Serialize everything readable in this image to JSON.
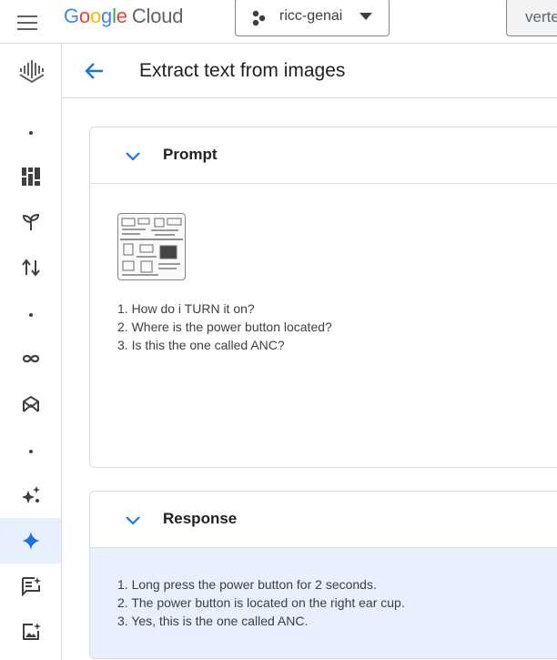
{
  "topbar": {
    "logo_word": [
      "G",
      "o",
      "o",
      "g",
      "l",
      "e"
    ],
    "logo_suffix": "Cloud",
    "project_name": "ricc-genai",
    "search_text": "verte"
  },
  "page": {
    "title": "Extract text from images"
  },
  "prompt": {
    "title": "Prompt",
    "lines": [
      "1. How do i TURN it on?",
      "2. Where is the power button located?",
      "3. Is this the one called ANC?"
    ]
  },
  "response": {
    "title": "Response",
    "lines": [
      "1. Long press the power button for 2 seconds.",
      "2. The power button is located on the right ear cup.",
      "3. Yes, this is the one called ANC."
    ]
  },
  "rail": {
    "items": [
      {
        "icon": "vertex-ai-logo-icon"
      },
      {
        "icon": "dot-icon"
      },
      {
        "icon": "dashboard-icon"
      },
      {
        "icon": "sprout-icon"
      },
      {
        "icon": "swap-vertical-icon"
      },
      {
        "icon": "dot-icon"
      },
      {
        "icon": "infinity-icon"
      },
      {
        "icon": "model-garden-icon"
      },
      {
        "icon": "dot-icon"
      },
      {
        "icon": "sparkle-cluster-icon"
      },
      {
        "icon": "sparkle-icon",
        "active": true
      },
      {
        "icon": "chat-prompt-icon"
      },
      {
        "icon": "image-generation-icon"
      }
    ]
  },
  "colors": {
    "accent_blue": "#1a73e8",
    "active_bg": "#e8f0fe",
    "border": "#dadce0",
    "text": "#202124"
  }
}
